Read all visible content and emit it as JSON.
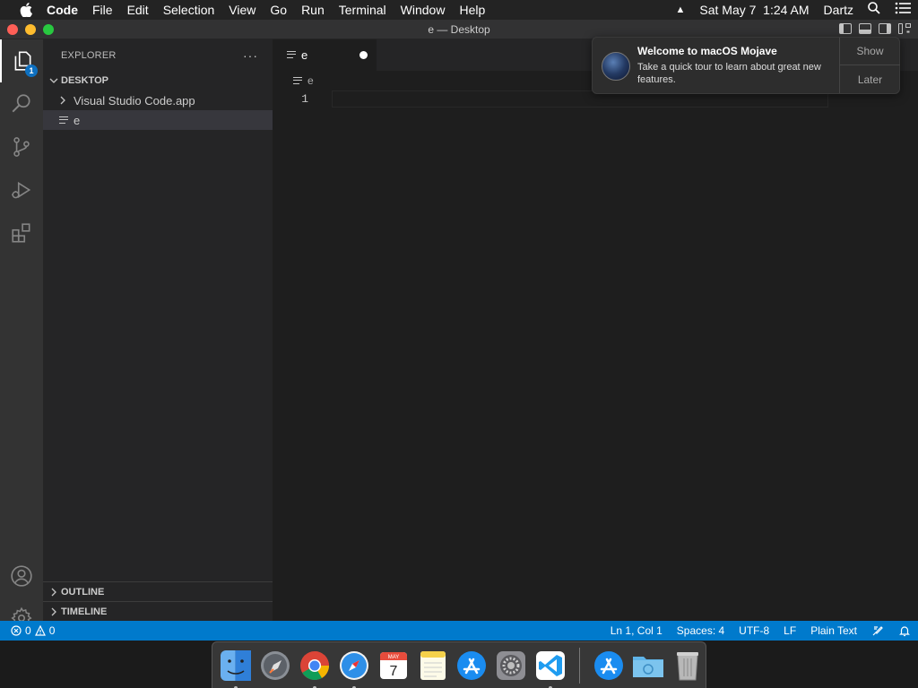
{
  "menubar": {
    "app_name": "Code",
    "menus": [
      "File",
      "Edit",
      "Selection",
      "View",
      "Go",
      "Run",
      "Terminal",
      "Window",
      "Help"
    ],
    "clock": "Sat May 7  1:24 AM",
    "user": "Dartz"
  },
  "window": {
    "title": "e — Desktop"
  },
  "activity": {
    "explorer_badge": "1"
  },
  "sidebar": {
    "header": "EXPLORER",
    "more": "···",
    "folder": "DESKTOP",
    "items": [
      {
        "label": "Visual Studio Code.app"
      },
      {
        "label": "e"
      }
    ],
    "outline": "OUTLINE",
    "timeline": "TIMELINE"
  },
  "editor": {
    "tab_label": "e",
    "breadcrumb": "e",
    "line_number": "1"
  },
  "statusbar": {
    "errors": "0",
    "warnings": "0",
    "position": "Ln 1, Col 1",
    "spaces": "Spaces: 4",
    "encoding": "UTF-8",
    "eol": "LF",
    "language": "Plain Text"
  },
  "notification": {
    "title": "Welcome to macOS Mojave",
    "body": "Take a quick tour to learn about great new features.",
    "show": "Show",
    "later": "Later"
  },
  "dock": {
    "apps": [
      "finder",
      "launchpad",
      "chrome",
      "safari",
      "calendar",
      "notes",
      "app-store",
      "system-preferences",
      "vscode",
      "app-store-downloads",
      "downloads-folder",
      "trash"
    ],
    "calendar_month": "MAY",
    "calendar_day": "7"
  },
  "colors": {
    "statusbar": "#007acc",
    "activitybar": "#333333",
    "sidebar": "#252526",
    "editor": "#1e1e1e",
    "badge": "#0e70c0"
  }
}
